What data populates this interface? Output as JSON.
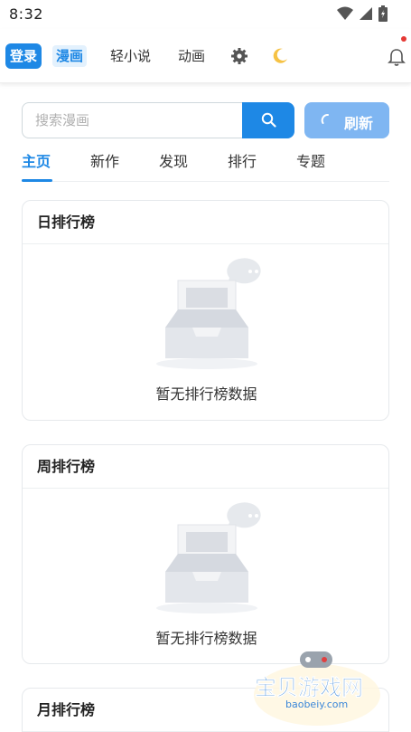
{
  "status_bar": {
    "time": "8:32"
  },
  "top_nav": {
    "login_label": "登录",
    "items": [
      {
        "label": "漫画",
        "active": true
      },
      {
        "label": "轻小说",
        "active": false
      },
      {
        "label": "动画",
        "active": false
      }
    ],
    "icons": [
      "gear-icon",
      "moon-icon",
      "bell-icon"
    ]
  },
  "search": {
    "placeholder": "搜索漫画",
    "value": "",
    "refresh_label": "刷新"
  },
  "tabs": [
    {
      "label": "主页",
      "active": true
    },
    {
      "label": "新作",
      "active": false
    },
    {
      "label": "发现",
      "active": false
    },
    {
      "label": "排行",
      "active": false
    },
    {
      "label": "专题",
      "active": false
    }
  ],
  "rankings": [
    {
      "title": "日排行榜",
      "empty_text": "暂无排行榜数据"
    },
    {
      "title": "周排行榜",
      "empty_text": "暂无排行榜数据"
    },
    {
      "title": "月排行榜",
      "empty_text": ""
    }
  ],
  "watermark": {
    "name": "宝贝游戏网",
    "url": "baobeiy.com"
  },
  "colors": {
    "accent": "#1e88e5",
    "refresh_bg": "#7fb6f2",
    "active_nav_bg": "#e3f1fd"
  }
}
